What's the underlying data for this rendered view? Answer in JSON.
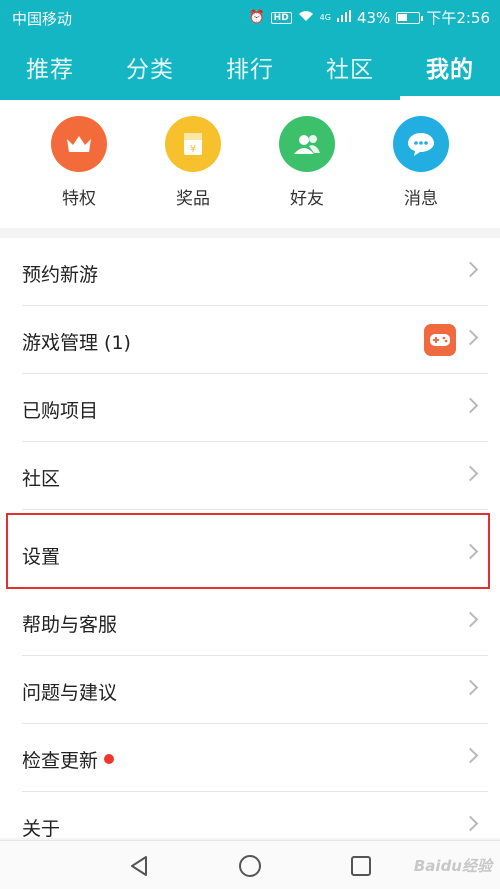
{
  "status": {
    "carrier": "中国移动",
    "hd": "HD",
    "network": "4G",
    "battery": "43%",
    "time": "下午2:56"
  },
  "tabs": [
    {
      "label": "推荐"
    },
    {
      "label": "分类"
    },
    {
      "label": "排行"
    },
    {
      "label": "社区"
    },
    {
      "label": "我的",
      "active": true
    }
  ],
  "quick_actions": [
    {
      "label": "特权",
      "icon": "crown-icon",
      "color": "#f36b3b"
    },
    {
      "label": "奖品",
      "icon": "gift-icon",
      "color": "#f7c12e"
    },
    {
      "label": "好友",
      "icon": "friends-icon",
      "color": "#3cc06a"
    },
    {
      "label": "消息",
      "icon": "message-icon",
      "color": "#22aee0"
    }
  ],
  "menu": [
    {
      "label": "预约新游"
    },
    {
      "label": "游戏管理 (1)",
      "badge_icon": "gamepad-icon"
    },
    {
      "label": "已购项目"
    },
    {
      "label": "社区"
    },
    {
      "label": "设置",
      "highlighted": true
    },
    {
      "label": "帮助与客服"
    },
    {
      "label": "问题与建议"
    },
    {
      "label": "检查更新",
      "red_dot": true
    },
    {
      "label": "关于"
    }
  ],
  "watermark": "Baidu经验",
  "colors": {
    "header": "#14b6c4",
    "highlight_border": "#e23030",
    "update_dot": "#f0352f"
  }
}
